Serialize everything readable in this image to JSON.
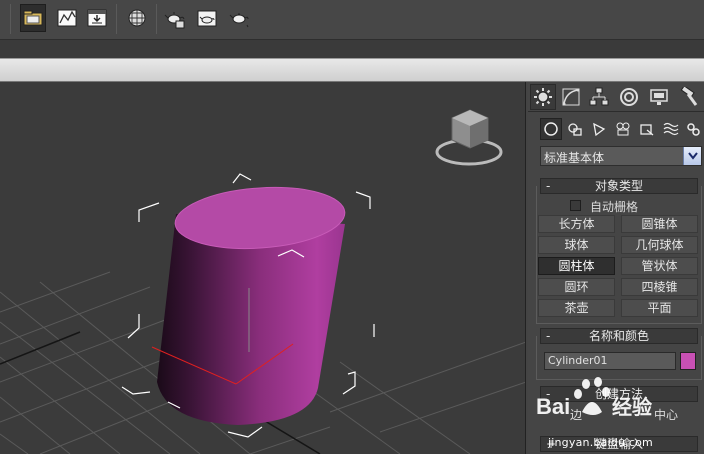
{
  "toolbar": {
    "buttons": [
      {
        "name": "scene-explorer",
        "icon": "folder-icon"
      },
      {
        "name": "curve-editor",
        "icon": "graph-icon"
      },
      {
        "name": "schematic-view",
        "icon": "download-panel-icon"
      },
      {
        "name": "material-editor",
        "icon": "checker-sphere-icon"
      },
      {
        "name": "render-setup",
        "icon": "teapot-render-setup-icon"
      },
      {
        "name": "rendered-frame-window",
        "icon": "teapot-frame-icon"
      },
      {
        "name": "render-production",
        "icon": "teapot-icon"
      }
    ]
  },
  "panel": {
    "tabs": [
      {
        "name": "create",
        "icon": "gear-sun-icon",
        "active": true
      },
      {
        "name": "modify",
        "icon": "modify-curve-icon"
      },
      {
        "name": "hierarchy",
        "icon": "hierarchy-icon"
      },
      {
        "name": "motion",
        "icon": "motion-wheel-icon"
      },
      {
        "name": "display",
        "icon": "monitor-icon"
      },
      {
        "name": "utilities",
        "icon": "hammer-icon"
      }
    ],
    "categories": [
      {
        "name": "geometry",
        "icon": "sphere-icon",
        "active": true
      },
      {
        "name": "shapes",
        "icon": "shapes-icon"
      },
      {
        "name": "lights",
        "icon": "light-icon"
      },
      {
        "name": "cameras",
        "icon": "camera-icon"
      },
      {
        "name": "helpers",
        "icon": "helper-icon"
      },
      {
        "name": "space-warps",
        "icon": "wave-icon"
      },
      {
        "name": "systems",
        "icon": "systems-gear-icon"
      }
    ],
    "dropdown": {
      "selected": "标准基本体"
    },
    "object_type": {
      "sign": "-",
      "title": "对象类型",
      "autogrid_label": "自动栅格",
      "buttons": [
        "长方体",
        "圆锥体",
        "球体",
        "几何球体",
        "圆柱体",
        "管状体",
        "圆环",
        "四棱锥",
        "茶壶",
        "平面"
      ],
      "active": "圆柱体"
    },
    "name_color": {
      "sign": "-",
      "title": "名称和颜色",
      "name_value": "Cylinder01",
      "color": "#c850b4"
    },
    "creation_method": {
      "sign": "-",
      "title": "创建方法",
      "options": [
        "边",
        "中心"
      ]
    },
    "keyboard_entry": {
      "sign": "+",
      "title": "键盘输入"
    }
  },
  "watermark": {
    "logo_text": "Bai 经验",
    "url": "jingyan.baidu.com"
  },
  "colors": {
    "cylinder": "#c850b4",
    "viewport_bg": "#3b3b3b",
    "panel_bg": "#454545"
  }
}
